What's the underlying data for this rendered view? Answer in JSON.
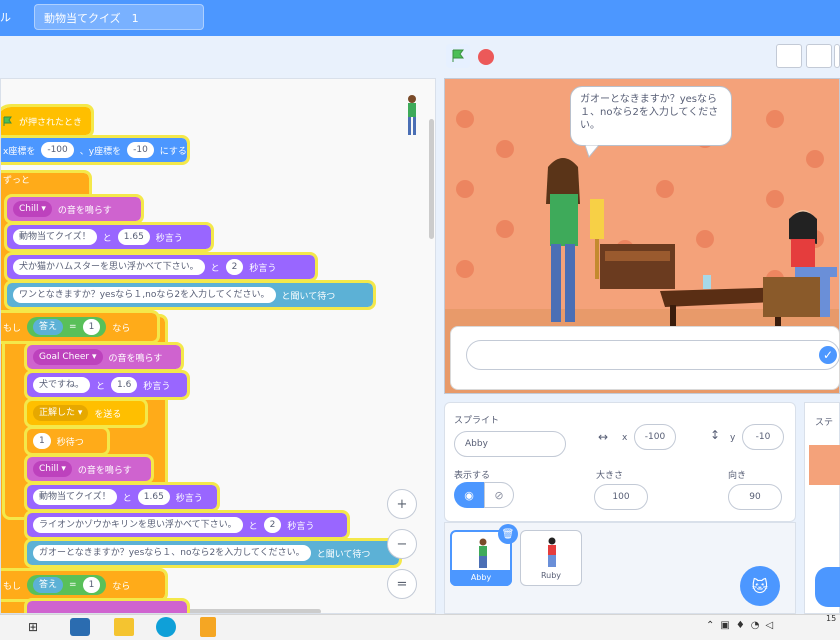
{
  "menubar": {
    "file_menu": "ル",
    "project_title": "動物当てクイズ　1"
  },
  "code_blocks": {
    "when_flag_clicked": "が押されたとき",
    "goto_text": "x座標を",
    "goto_x": "-100",
    "goto_y_text": "、y座標を",
    "goto_y": "-10",
    "goto_end": "にする",
    "forever": "ずっと",
    "play1_sound": "Chill",
    "play_suffix": "の音を鳴らす",
    "say1_text": "動物当てクイズ！",
    "to": "と",
    "say1_secs": "1.65",
    "secs_say": "秒言う",
    "say2_text": "犬か猫かハムスターを思い浮かべて下さい。",
    "say2_secs": "2",
    "ask1_text": "ワンとなきますか？yesなら１,noなら2を入力してください。",
    "ask_suffix": "と聞いて待つ",
    "if_label": "もし",
    "answer": "答え",
    "equals": "=",
    "if1_value": "1",
    "then": "なら",
    "play2_sound": "Goal Cheer",
    "say3_text": "犬ですね。",
    "say3_secs": "1.6",
    "broadcast_msg": "正解した",
    "broadcast_suffix": "を送る",
    "wait_secs": "1",
    "wait_suffix": "秒待つ",
    "play3_sound": "Chill",
    "say4_text": "動物当てクイズ！",
    "say4_secs": "1.65",
    "say5_text": "ライオンかゾウかキリンを思い浮かべて下さい。",
    "say5_secs": "2",
    "ask2_text": "ガオーとなきますか？yesなら１、noなら2を入力してください。",
    "if2_value": "1"
  },
  "zoom": {
    "zoom_in": "+",
    "zoom_out": "−",
    "reset": "="
  },
  "stage": {
    "bubble_text": "ガオーとなきますか？yesなら１、noなら2を入力してください。",
    "answer_value": ""
  },
  "sprite_info": {
    "title": "スプライト",
    "name_value": "Abby",
    "x_label": "x",
    "x_value": "-100",
    "y_label": "y",
    "y_value": "-10",
    "show_label": "表示する",
    "size_label": "大きさ",
    "size_value": "100",
    "direction_label": "向き",
    "direction_value": "90"
  },
  "sprites": [
    {
      "name": "Abby"
    },
    {
      "name": "Ruby"
    }
  ],
  "stage_panel": {
    "title": "ステ"
  },
  "taskbar": {
    "clock": "15"
  },
  "colors": {
    "menubar": "#4c97ff",
    "events": "#ffbf00",
    "motion": "#4c97ff",
    "control": "#ffab19",
    "sound": "#cf63cf",
    "looks": "#9966ff",
    "sensing": "#5cb1d6",
    "operators": "#59c059"
  }
}
